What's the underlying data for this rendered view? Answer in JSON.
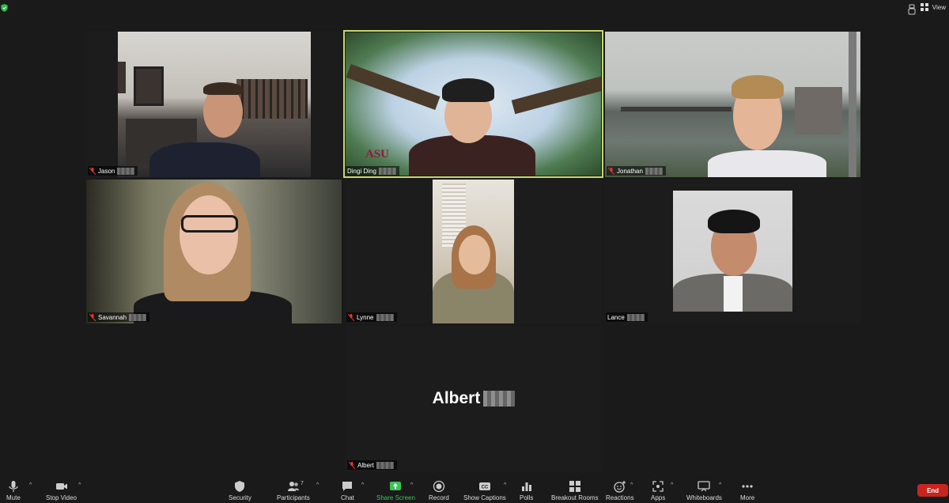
{
  "top": {
    "view_label": "View"
  },
  "participants": [
    {
      "name": "Jason"
    },
    {
      "name": "Dingi Ding"
    },
    {
      "name": "Jonathan"
    },
    {
      "name": "Savannah"
    },
    {
      "name": "Lynne"
    },
    {
      "name": "Lance"
    },
    {
      "name": "Albert"
    }
  ],
  "albert_display_name": "Albert",
  "toolbar": {
    "mute": "Mute",
    "stop_video": "Stop Video",
    "security": "Security",
    "participants": "Participants",
    "participant_count": "7",
    "chat": "Chat",
    "share_screen": "Share Screen",
    "record": "Record",
    "show_captions": "Show Captions",
    "polls": "Polls",
    "breakout_rooms": "Breakout Rooms",
    "reactions": "Reactions",
    "apps": "Apps",
    "whiteboards": "Whiteboards",
    "more": "More",
    "end": "End"
  },
  "colors": {
    "active_speaker": "#c7d96c",
    "share_green": "#3ec25a",
    "end_red": "#c9251f"
  }
}
